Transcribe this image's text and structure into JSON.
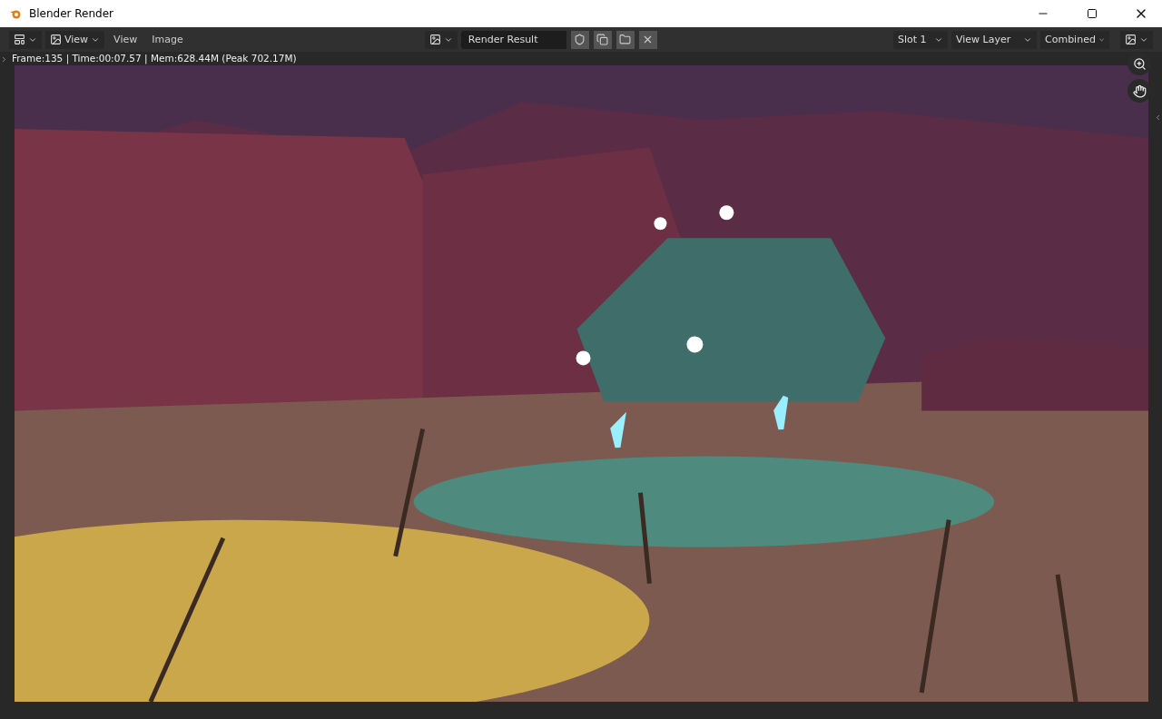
{
  "window": {
    "title": "Blender Render"
  },
  "header": {
    "view_menu": "View",
    "menus": [
      "View",
      "Image"
    ],
    "image_name": "Render Result",
    "slot": "Slot 1",
    "view_layer": "View Layer",
    "pass": "Combined"
  },
  "stats": "Frame:135 | Time:00:07.57 | Mem:628.44M (Peak 702.17M)"
}
